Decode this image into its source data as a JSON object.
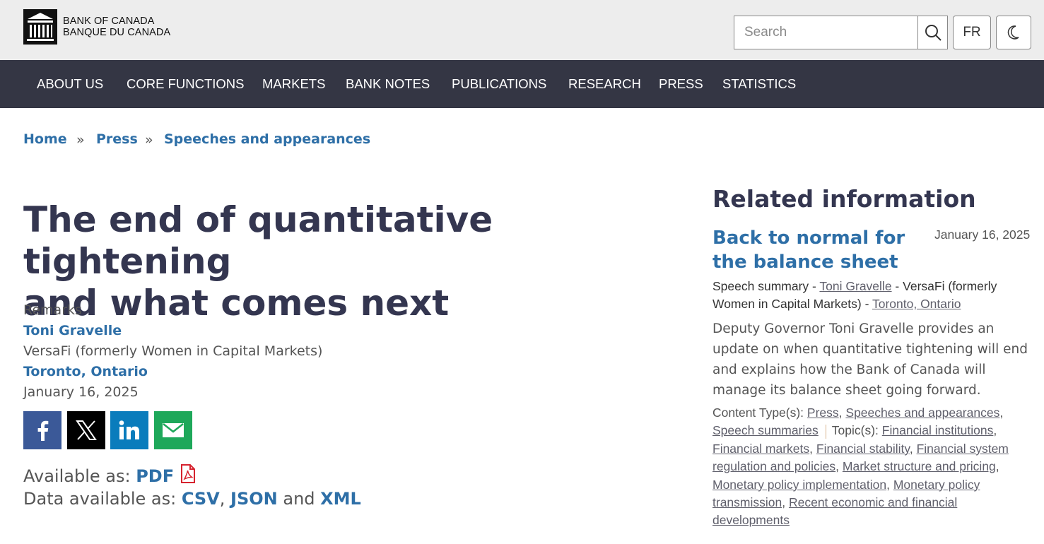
{
  "header": {
    "logo_line1": "BANK OF CANADA",
    "logo_line2": "BANQUE DU CANADA",
    "search_placeholder": "Search",
    "lang_label": "FR"
  },
  "nav": {
    "items": [
      "ABOUT US",
      "CORE FUNCTIONS",
      "MARKETS",
      "BANK NOTES",
      "PUBLICATIONS",
      "RESEARCH",
      "PRESS",
      "STATISTICS"
    ]
  },
  "breadcrumb": {
    "items": [
      "Home",
      "Press",
      "Speeches and appearances"
    ],
    "separator": "»"
  },
  "article": {
    "title_line1": "The end of quantitative tightening",
    "title_line2": "and what comes next",
    "type": "Remarks",
    "speaker": "Toni Gravelle",
    "organization": "VersaFi (formerly Women in Capital Markets)",
    "location": "Toronto, Ontario",
    "date": "January 16, 2025",
    "available_label": "Available as:",
    "pdf_label": "PDF",
    "data_label": "Data available as:",
    "csv_label": "CSV",
    "json_label": "JSON",
    "and_label": "and",
    "xml_label": "XML"
  },
  "colors": {
    "nav_bg": "#343644",
    "link": "#2e6fa7",
    "heading": "#343650",
    "facebook": "#3b5998",
    "x": "#000000",
    "linkedin": "#0a7cbc",
    "email": "#1ea85a",
    "pdf_icon": "#d6232f"
  },
  "sidebar": {
    "heading": "Related information",
    "item_title": "Back to normal for the balance sheet",
    "item_date": "January 16, 2025",
    "byline_prefix": "Speech summary",
    "byline_speaker": "Toni Gravelle",
    "byline_org": "VersaFi (formerly Women in Capital Markets)",
    "byline_location": "Toronto, Ontario",
    "description": "Deputy Governor Toni Gravelle provides an update on when quantitative tightening will end and explains how the Bank of Canada will manage its balance sheet going forward.",
    "content_types_label": "Content Type(s):",
    "content_types": [
      "Press",
      "Speeches and appearances",
      "Speech summaries"
    ],
    "topics_label": "Topic(s):",
    "topics": [
      "Financial institutions",
      "Financial markets",
      "Financial stability",
      "Financial system regulation and policies",
      "Market structure and pricing",
      "Monetary policy implementation",
      "Monetary policy transmission",
      "Recent economic and financial developments"
    ]
  }
}
